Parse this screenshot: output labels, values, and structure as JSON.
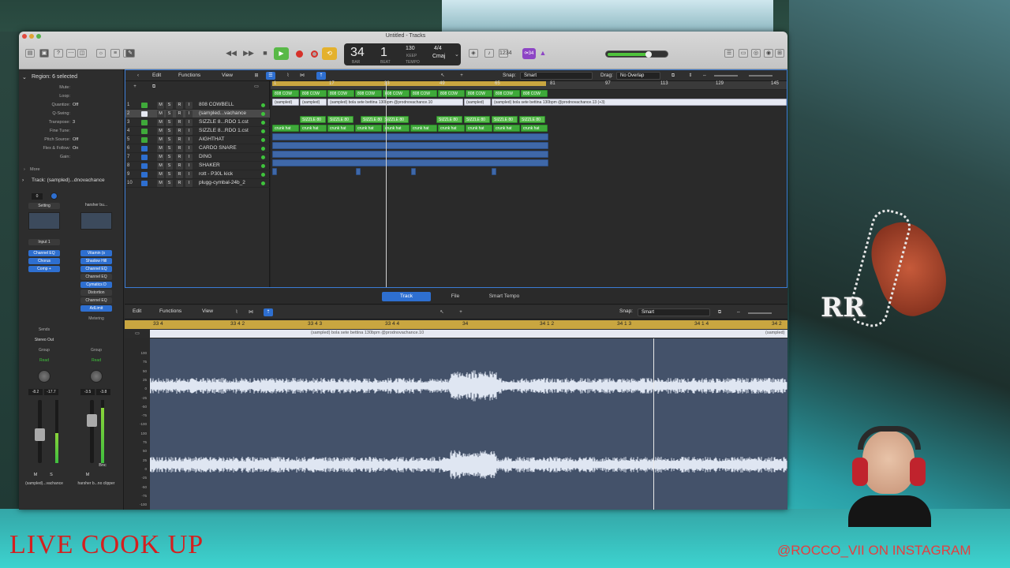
{
  "overlay": {
    "live_text": "LIVE COOK UP",
    "instagram_text": "@ROCCO_VII ON INSTAGRAM",
    "pendant_text": "RR"
  },
  "window": {
    "title": "Untitled - Tracks"
  },
  "lcd": {
    "bar": "34",
    "beat": "1",
    "bar_label": "BAR",
    "beat_label": "BEAT",
    "tempo": "130",
    "tempo_mode": "KEEP",
    "tempo_label": "TEMPO",
    "signature": "4/4",
    "key": "Cmaj"
  },
  "toolbar": {
    "purple_label": "⚩34"
  },
  "inspector": {
    "region_header": "Region: 6 selected",
    "rows": [
      {
        "k": "Mute:",
        "v": ""
      },
      {
        "k": "Loop:",
        "v": ""
      },
      {
        "k": "Quantize:",
        "v": "Off"
      },
      {
        "k": "Q-Swing:",
        "v": ""
      },
      {
        "k": "Transpose:",
        "v": "3"
      },
      {
        "k": "Fine Tune:",
        "v": ""
      },
      {
        "k": "Pitch Source:",
        "v": "Off"
      },
      {
        "k": "Flex & Follow:",
        "v": "On"
      },
      {
        "k": "Gain:",
        "v": ""
      }
    ],
    "more_label": "More",
    "track_header": "Track: (sampled)...dnovachance",
    "strip_left": {
      "setting": "Setting",
      "input": "Input 1",
      "plugins": [
        "Channel EQ",
        "Chorus",
        "Comp +"
      ],
      "sends": "Sends",
      "output": "Stereo Out",
      "group": "Group",
      "automation": "Read",
      "readout_l": "-8.2",
      "readout_r": "-17.7",
      "m": "M",
      "s": "S",
      "name": "(sampled)...vachance"
    },
    "strip_right": {
      "setting": "harsher bu...",
      "plugins": [
        "Vitamin (s",
        "Shadow Hill",
        "Channel EQ",
        "Channel EQ",
        "Cymatics D",
        "Distortion",
        "Channel EQ",
        "AdLimit"
      ],
      "extra": "Metering",
      "group": "Group",
      "automation": "Read",
      "readout_l": "-3.5",
      "readout_r": "-3.8",
      "m": "M",
      "bnc": "Bnc",
      "name": "harsher b...no clipper"
    }
  },
  "tracks_toolbar": {
    "edit": "Edit",
    "functions": "Functions",
    "view": "View",
    "snap_label": "Snap:",
    "snap_value": "Smart",
    "drag_label": "Drag:",
    "drag_value": "No Overlap"
  },
  "ruler": [
    "1",
    "17",
    "33",
    "49",
    "65",
    "81",
    "97",
    "113",
    "129",
    "145"
  ],
  "tracks": [
    {
      "num": "1",
      "name": "808 COWBELL",
      "color": "#3fa93a"
    },
    {
      "num": "2",
      "name": "(sampled...vachance",
      "color": "#e6e9f2"
    },
    {
      "num": "3",
      "name": "SIZZLE 8...RDO 1.cst",
      "color": "#3fa93a"
    },
    {
      "num": "4",
      "name": "SIZZLE 8...RDO 1.cst",
      "color": "#3fa93a"
    },
    {
      "num": "5",
      "name": "AIGHTHAT",
      "color": "#3fa93a"
    },
    {
      "num": "6",
      "name": "CARDO SNARE",
      "color": "#2e6fd0"
    },
    {
      "num": "7",
      "name": "DING",
      "color": "#2e6fd0"
    },
    {
      "num": "8",
      "name": "SHAKER",
      "color": "#2e6fd0"
    },
    {
      "num": "9",
      "name": "rott - P30L kick",
      "color": "#2e6fd0"
    },
    {
      "num": "10",
      "name": "plugg-cymbal-24b_2",
      "color": "#2e6fd0"
    }
  ],
  "regions": {
    "cowbell": "808 COW",
    "sampled_short": "(sampled)",
    "sampled_long": "(sampled) bola sete bettina 130bpm @prodnovachance.10",
    "sampled_tail": "(sampled) bola sete bettina 130bpm @prodnovachance.13 (+3)",
    "sizzle": "SIZZLE 80",
    "crunk": "crunk hat"
  },
  "editor": {
    "tabs": [
      "Track",
      "File",
      "Smart Tempo"
    ],
    "edit": "Edit",
    "functions": "Functions",
    "view": "View",
    "snap_label": "Snap:",
    "snap_value": "Smart",
    "ruler": [
      "33 4",
      "33 4 2",
      "33 4 3",
      "33 4 4",
      "34",
      "34 1 2",
      "34 1 3",
      "34 1 4",
      "34 2"
    ],
    "region_label": "(sampled) bola sete bettina 130bpm @prodnovachance.10",
    "region_label_right": "(sampled)",
    "scale": [
      "100",
      "75",
      "50",
      "25",
      "0",
      "-25",
      "-50",
      "-75",
      "-100",
      "100",
      "75",
      "50",
      "25",
      "0",
      "-25",
      "-50",
      "-75",
      "-100"
    ]
  }
}
